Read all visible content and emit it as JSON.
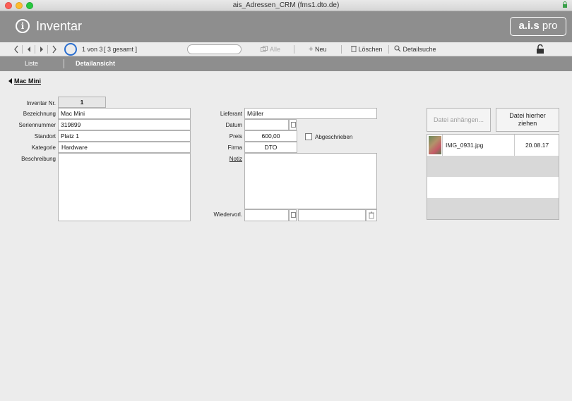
{
  "window": {
    "title": "ais_Adressen_CRM (fms1.dto.de)"
  },
  "header": {
    "title": "Inventar",
    "logo_bold": "a.i.s",
    "logo_light": "pro"
  },
  "toolbar": {
    "record_status": "1 von 3",
    "record_total": "[ 3 gesamt ]",
    "alle_label": "Alle",
    "new_label": "Neu",
    "delete_label": "Löschen",
    "detail_search_label": "Detailsuche",
    "search_value": ""
  },
  "tabs": {
    "list": "Liste",
    "detail": "Detailansicht"
  },
  "back_link": "Mac Mini",
  "form": {
    "inventar_nr": {
      "label": "Inventar Nr.",
      "value": "1"
    },
    "bezeichnung": {
      "label": "Bezeichnung",
      "value": "Mac Mini"
    },
    "seriennummer": {
      "label": "Seriennummer",
      "value": "319899"
    },
    "standort": {
      "label": "Standort",
      "value": "Platz 1"
    },
    "kategorie": {
      "label": "Kategorie",
      "value": "Hardware"
    },
    "beschreibung": {
      "label": "Beschreibung",
      "value": ""
    },
    "lieferant": {
      "label": "Lieferant",
      "value": "Müller"
    },
    "datum": {
      "label": "Datum",
      "value": ""
    },
    "preis": {
      "label": "Preis",
      "value": "600,00"
    },
    "abgeschrieben": {
      "label": "Abgeschrieben",
      "checked": false
    },
    "firma": {
      "label": "Firma",
      "value": "DTO"
    },
    "notiz": {
      "label": "Notiz",
      "value": ""
    },
    "wiedervorl": {
      "label": "Wiedervorl.",
      "date": "",
      "text": ""
    }
  },
  "attachments": {
    "attach_button": "Datei anhängen...",
    "drop_button_line1": "Datei hierher",
    "drop_button_line2": "ziehen",
    "files": [
      {
        "name": "IMG_0931.jpg",
        "date": "20.08.17"
      }
    ]
  }
}
